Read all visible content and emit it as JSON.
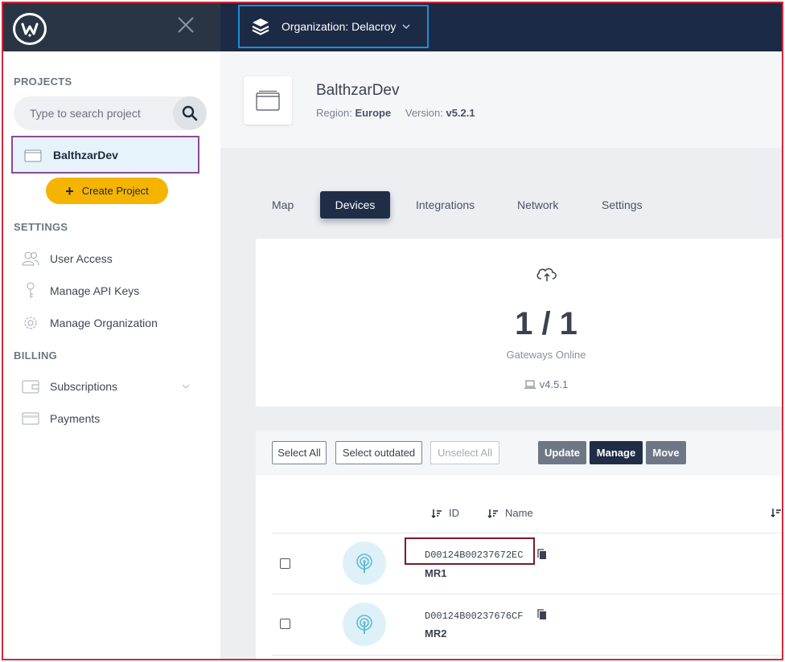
{
  "header": {
    "organization_label": "Organization: Delacroy"
  },
  "sidebar": {
    "projects_title": "PROJECTS",
    "search_placeholder": "Type to search project",
    "project_item": "BalthzarDev",
    "create_project_label": "Create Project",
    "settings_title": "SETTINGS",
    "settings_items": [
      {
        "label": "User Access",
        "icon": "users-icon"
      },
      {
        "label": "Manage API Keys",
        "icon": "key-icon"
      },
      {
        "label": "Manage Organization",
        "icon": "gear-icon"
      }
    ],
    "billing_title": "BILLING",
    "billing_items": [
      {
        "label": "Subscriptions",
        "icon": "wallet-icon"
      },
      {
        "label": "Payments",
        "icon": "credit-card-icon"
      }
    ]
  },
  "project": {
    "name": "BalthzarDev",
    "region_label": "Region:",
    "region_value": "Europe",
    "version_label": "Version:",
    "version_value": "v5.2.1"
  },
  "tabs": [
    {
      "label": "Map",
      "active": false
    },
    {
      "label": "Devices",
      "active": true
    },
    {
      "label": "Integrations",
      "active": false
    },
    {
      "label": "Network",
      "active": false
    },
    {
      "label": "Settings",
      "active": false
    }
  ],
  "gateways": {
    "count": "1 / 1",
    "label": "Gateways Online",
    "version": "v4.5.1"
  },
  "toolbar": {
    "select_all": "Select All",
    "select_outdated": "Select outdated",
    "unselect_all": "Unselect All",
    "update": "Update",
    "manage": "Manage",
    "move": "Move"
  },
  "table": {
    "col_id": "ID",
    "col_name": "Name",
    "rows": [
      {
        "id": "D00124B00237672EC",
        "name": "MR1"
      },
      {
        "id": "D00124B00237676CF",
        "name": "MR2"
      }
    ]
  },
  "colors": {
    "topbar": "#1c2a45",
    "accent_yellow": "#f4b400",
    "active_tab": "#1f2d47",
    "org_highlight": "#1a8fd8",
    "project_highlight": "#8e4a96",
    "frame": "#d0283a"
  }
}
